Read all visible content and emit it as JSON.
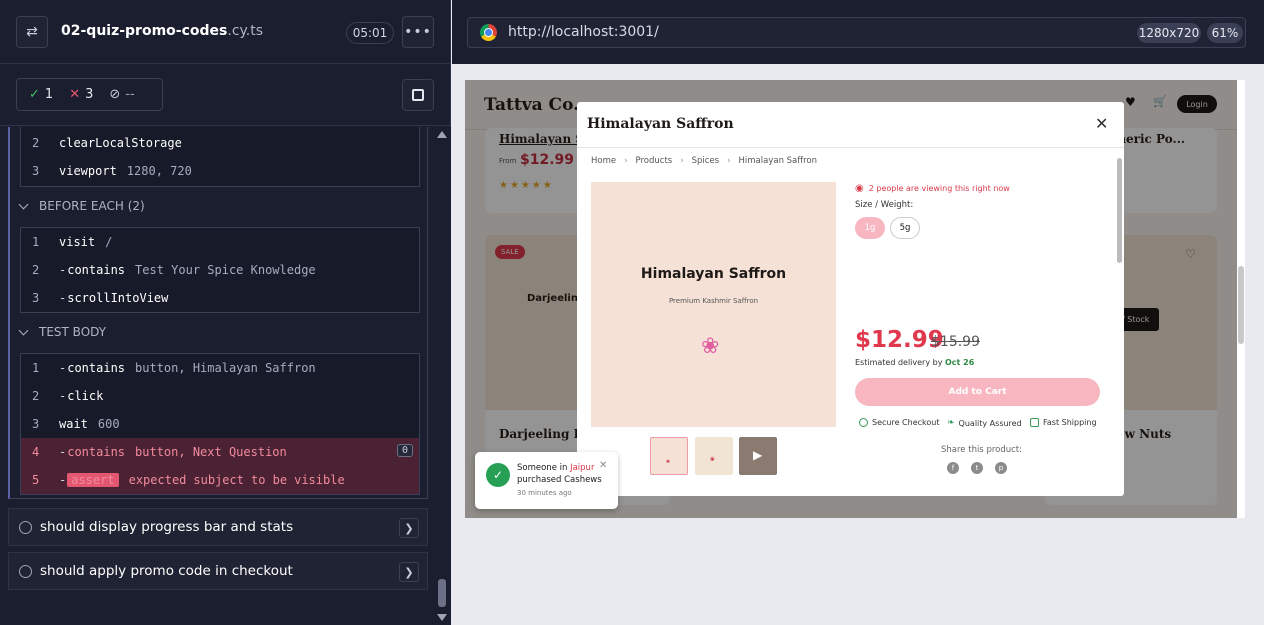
{
  "runner": {
    "spec_base": "02-quiz-promo-codes",
    "spec_ext": ".cy.ts",
    "timer": "05:01",
    "stats": {
      "passed": "1",
      "failed": "3",
      "pending": "--"
    }
  },
  "reporter": {
    "setup_commands": [
      {
        "num": "2",
        "name": "clearLocalStorage",
        "arg": ""
      },
      {
        "num": "3",
        "name": "viewport",
        "arg": "1280, 720"
      }
    ],
    "before_each_label": "BEFORE EACH (2)",
    "before_each_commands": [
      {
        "num": "1",
        "name": "visit",
        "arg": "/"
      },
      {
        "num": "2",
        "dash": "-",
        "name": "contains",
        "arg": "Test Your Spice Knowledge"
      },
      {
        "num": "3",
        "dash": "-",
        "name": "scrollIntoView",
        "arg": ""
      }
    ],
    "test_body_label": "TEST BODY",
    "test_body_commands": [
      {
        "num": "1",
        "dash": "-",
        "name": "contains",
        "arg": "button, Himalayan Saffron"
      },
      {
        "num": "2",
        "dash": "-",
        "name": "click",
        "arg": ""
      },
      {
        "num": "3",
        "name": "wait",
        "arg": "600"
      },
      {
        "num": "4",
        "dash": "-",
        "name": "contains",
        "arg": "button, Next Question",
        "badge": "0"
      },
      {
        "num": "5",
        "dash": "-",
        "name": "assert",
        "arg_parts": [
          "expected",
          "subject",
          "to be",
          "visible"
        ]
      }
    ],
    "pending_tests": [
      "should display progress bar and stats",
      "should apply promo code in checkout"
    ]
  },
  "browser": {
    "url": "http://localhost:3001/",
    "viewport_size": "1280x720",
    "zoom": "61%"
  },
  "site": {
    "logo": "Tattva Co.",
    "login": "Login",
    "bg_card_titles": [
      "Himalayan Sa",
      "rmeric Po...",
      "Darjeelin",
      "Darjeeling Fir",
      "ew Nuts"
    ],
    "bg_price_prefix": "From",
    "bg_price": "$12.99",
    "bg_sale": "SALE",
    "bg_oos": "of Stock"
  },
  "modal": {
    "title": "Himalayan Saffron",
    "breadcrumb": [
      "Home",
      "Products",
      "Spices",
      "Himalayan Saffron"
    ],
    "image_title": "Himalayan Saffron",
    "image_subtitle": "Premium Kashmir Saffron",
    "viewing": "2 people are viewing this right now",
    "size_label": "Size / Weight:",
    "sizes": [
      "1g",
      "5g"
    ],
    "price": "$12.99",
    "old_price": "$15.99",
    "delivery_prefix": "Estimated delivery by",
    "delivery_date": "Oct 26",
    "add_to_cart": "Add to Cart",
    "badges": [
      "Secure Checkout",
      "Quality Assured",
      "Fast Shipping"
    ],
    "share_label": "Share this product:"
  },
  "toast": {
    "line1_prefix": "Someone in",
    "city": "Jaipur",
    "line2": "purchased Cashews",
    "time": "30 minutes ago"
  },
  "colors": {
    "runner_bg": "#1b1e2e",
    "fail_row": "#4a2234",
    "assert_tag": "#e45770",
    "price_red": "#e0394d",
    "add_cart_pink": "#f8b7c0"
  }
}
